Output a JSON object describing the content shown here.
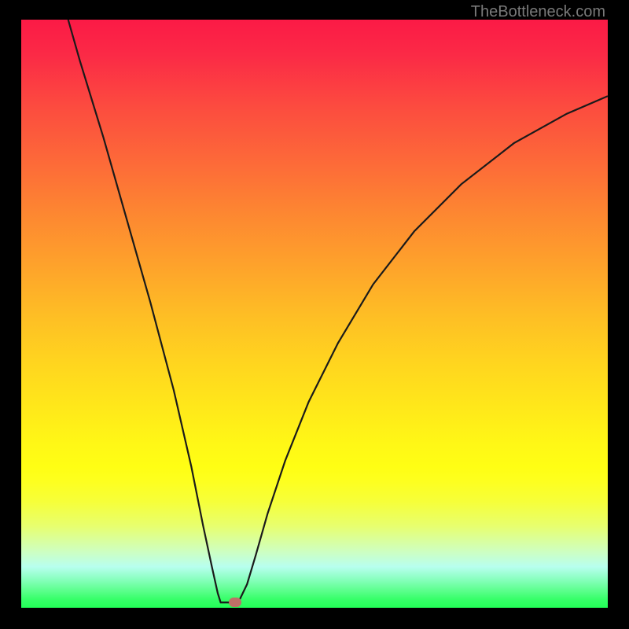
{
  "watermark": "TheBottleneck.com",
  "chart_data": {
    "type": "line",
    "title": "",
    "xlabel": "",
    "ylabel": "",
    "xlim": [
      0,
      100
    ],
    "ylim": [
      0,
      100
    ],
    "series": [
      {
        "name": "bottleneck-curve",
        "points": [
          {
            "x": 8.0,
            "y": 100
          },
          {
            "x": 10.0,
            "y": 93
          },
          {
            "x": 14.0,
            "y": 80
          },
          {
            "x": 18.0,
            "y": 66
          },
          {
            "x": 22.0,
            "y": 52
          },
          {
            "x": 26.0,
            "y": 37
          },
          {
            "x": 29.0,
            "y": 24
          },
          {
            "x": 31.0,
            "y": 14
          },
          {
            "x": 32.5,
            "y": 7
          },
          {
            "x": 33.5,
            "y": 2.5
          },
          {
            "x": 34.0,
            "y": 0.9
          },
          {
            "x": 35.5,
            "y": 0.9
          },
          {
            "x": 36.5,
            "y": 0.9
          },
          {
            "x": 37.2,
            "y": 1.3
          },
          {
            "x": 38.5,
            "y": 4
          },
          {
            "x": 40.0,
            "y": 9
          },
          {
            "x": 42.0,
            "y": 16
          },
          {
            "x": 45.0,
            "y": 25
          },
          {
            "x": 49.0,
            "y": 35
          },
          {
            "x": 54.0,
            "y": 45
          },
          {
            "x": 60.0,
            "y": 55
          },
          {
            "x": 67.0,
            "y": 64
          },
          {
            "x": 75.0,
            "y": 72
          },
          {
            "x": 84.0,
            "y": 79
          },
          {
            "x": 93.0,
            "y": 84
          },
          {
            "x": 100.0,
            "y": 87
          }
        ]
      }
    ],
    "marker": {
      "x": 36.5,
      "y": 0.9
    }
  },
  "colors": {
    "background": "#000000",
    "curve": "#1a1a1a",
    "marker": "#bd7067"
  }
}
